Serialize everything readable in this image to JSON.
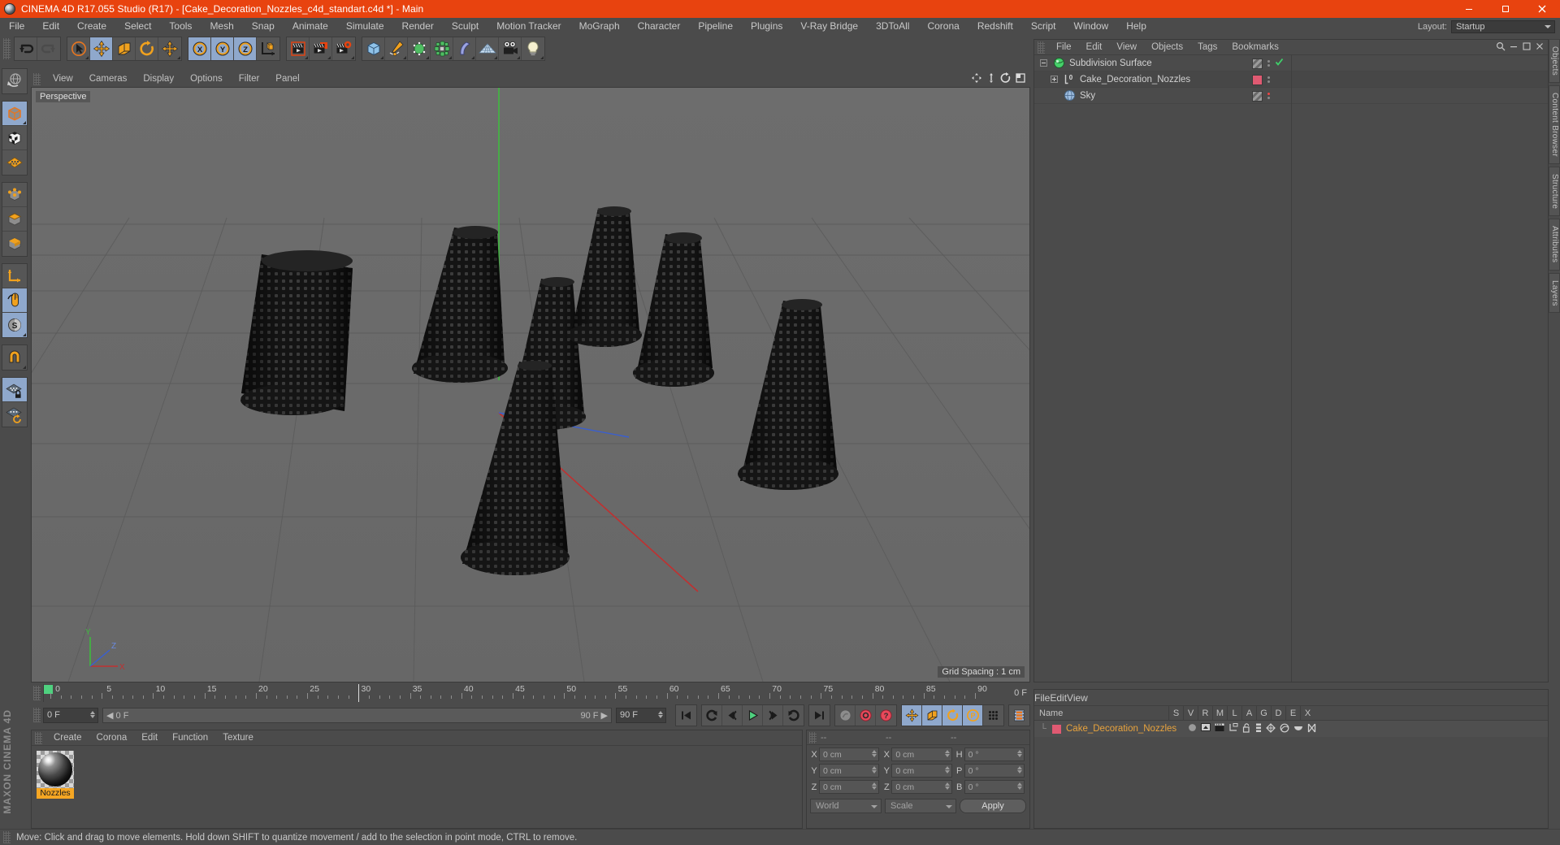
{
  "window": {
    "title": "CINEMA 4D R17.055 Studio (R17) - [Cake_Decoration_Nozzles_c4d_standart.c4d *] - Main",
    "minimize": "–",
    "maximize": "▢",
    "close": "✕"
  },
  "menubar": {
    "items": [
      "File",
      "Edit",
      "Create",
      "Select",
      "Tools",
      "Mesh",
      "Snap",
      "Animate",
      "Simulate",
      "Render",
      "Sculpt",
      "Motion Tracker",
      "MoGraph",
      "Character",
      "Pipeline",
      "Plugins",
      "V-Ray Bridge",
      "3DToAll",
      "Corona",
      "Redshift",
      "Script",
      "Window",
      "Help"
    ],
    "layout_label": "Layout:",
    "layout_value": "Startup"
  },
  "toolbar": {
    "groups": [
      {
        "name": "history",
        "buttons": [
          {
            "name": "undo-button",
            "icon": "undo-icon",
            "active": false,
            "disabled": false
          },
          {
            "name": "redo-button",
            "icon": "redo-icon",
            "active": false,
            "disabled": true
          }
        ]
      },
      {
        "name": "transform",
        "buttons": [
          {
            "name": "live-selection-button",
            "icon": "cursor-circle-icon",
            "active": false,
            "disabled": false
          },
          {
            "name": "move-tool-button",
            "icon": "move-arrows-icon",
            "active": true,
            "disabled": false
          },
          {
            "name": "scale-tool-button",
            "icon": "scale-box-icon",
            "active": false,
            "disabled": false
          },
          {
            "name": "rotate-tool-button",
            "icon": "rotate-arc-icon",
            "active": false,
            "disabled": false
          },
          {
            "name": "move-dup-button",
            "icon": "move-arrows-icon",
            "active": false,
            "disabled": false
          }
        ]
      },
      {
        "name": "axis-locks",
        "buttons": [
          {
            "name": "lock-x-button",
            "icon": "axis-x-icon",
            "active": true,
            "disabled": false
          },
          {
            "name": "lock-y-button",
            "icon": "axis-y-icon",
            "active": true,
            "disabled": false
          },
          {
            "name": "lock-z-button",
            "icon": "axis-z-icon",
            "active": true,
            "disabled": false
          },
          {
            "name": "world-coordinates-button",
            "icon": "world-axis-cube-icon",
            "active": false,
            "disabled": false
          }
        ]
      },
      {
        "name": "render",
        "buttons": [
          {
            "name": "render-view-button",
            "icon": "clapper-play-icon",
            "active": false,
            "disabled": false
          },
          {
            "name": "render-to-picture-viewer-button",
            "icon": "clapper-picture-icon",
            "active": false,
            "disabled": false
          },
          {
            "name": "render-settings-button",
            "icon": "clapper-gear-icon",
            "active": false,
            "disabled": false
          }
        ]
      },
      {
        "name": "create",
        "buttons": [
          {
            "name": "add-cube-button",
            "icon": "cube-blue-icon",
            "active": false,
            "disabled": false
          },
          {
            "name": "add-spline-button",
            "icon": "pen-spline-icon",
            "active": false,
            "disabled": false
          },
          {
            "name": "add-nurbs-button",
            "icon": "nurbs-green-icon",
            "active": false,
            "disabled": false
          },
          {
            "name": "add-array-button",
            "icon": "array-green-icon",
            "active": false,
            "disabled": false
          },
          {
            "name": "add-bend-button",
            "icon": "bend-deformer-icon",
            "active": false,
            "disabled": false
          },
          {
            "name": "add-floor-button",
            "icon": "floor-grid-icon",
            "active": false,
            "disabled": false
          },
          {
            "name": "add-camera-button",
            "icon": "camera-icon",
            "active": false,
            "disabled": false
          },
          {
            "name": "add-light-button",
            "icon": "light-bulb-icon",
            "active": false,
            "disabled": false
          }
        ]
      }
    ]
  },
  "left_toolbar": {
    "groups": [
      [
        {
          "name": "undo-view-button",
          "icon": "globe-undo-icon",
          "active": false
        }
      ],
      [
        {
          "name": "model-mode-button",
          "icon": "cube-solid-icon",
          "active": true
        },
        {
          "name": "texture-mode-button",
          "icon": "cube-checker-icon",
          "active": false
        },
        {
          "name": "workplane-mode-button",
          "icon": "grid-plane-icon",
          "active": false
        }
      ],
      [
        {
          "name": "points-mode-button",
          "icon": "cube-points-icon",
          "active": false
        },
        {
          "name": "edges-mode-button",
          "icon": "cube-edges-icon",
          "active": false
        },
        {
          "name": "polygons-mode-button",
          "icon": "cube-polygons-icon",
          "active": false
        }
      ],
      [
        {
          "name": "object-axis-button",
          "icon": "axis-corner-icon",
          "active": false
        },
        {
          "name": "viewport-solo-button",
          "icon": "mouse-icon",
          "active": true
        },
        {
          "name": "enable-axis-button",
          "icon": "s-circle-icon",
          "active": true
        }
      ],
      [
        {
          "name": "magnet-tool-button",
          "icon": "magnet-icon",
          "active": false
        }
      ],
      [
        {
          "name": "workplane-lock-button",
          "icon": "grid-lock-icon",
          "active": true
        },
        {
          "name": "workplane-rotate-button",
          "icon": "grid-rotate-icon",
          "active": false
        }
      ]
    ],
    "brand": "MAXON CINEMA 4D"
  },
  "viewport": {
    "menu": [
      "View",
      "Cameras",
      "Display",
      "Options",
      "Filter",
      "Panel"
    ],
    "label": "Perspective",
    "grid_spacing": "Grid Spacing : 1 cm",
    "header_icons": [
      "move-view-icon",
      "pan-view-icon",
      "rotate-view-icon",
      "maximize-view-icon"
    ],
    "scene": {
      "objects": "7 black textured cone-shaped cake decoration nozzles on a grey grid floor",
      "background_color": "#6b6b6b",
      "floor_color": "#6e6e6e",
      "object_color": "#1a1a1a",
      "axis_x_color": "#c03030",
      "axis_y_color": "#3fbb3f",
      "axis_z_color": "#3a5fd0"
    }
  },
  "object_manager": {
    "menu": [
      "File",
      "Edit",
      "View",
      "Objects",
      "Tags",
      "Bookmarks"
    ],
    "rows": [
      {
        "name": "Subdivision Surface",
        "icon": "subdivision-surface-icon",
        "selected": false,
        "indent": 0,
        "expander": "minus",
        "tag_color": "#8a8a8a",
        "check": true
      },
      {
        "name": "Cake_Decoration_Nozzles",
        "icon": "null-object-icon",
        "selected": false,
        "indent": 1,
        "expander": "plus",
        "tag_color": "#e05a72",
        "check": false
      },
      {
        "name": "Sky",
        "icon": "sky-object-icon",
        "selected": false,
        "indent": 1,
        "expander": "none",
        "tag_color": "#8a8a8a",
        "check": false
      }
    ]
  },
  "dock_right": {
    "tabs": [
      "Objects",
      "Content Browser",
      "Structure",
      "Attributes",
      "Layers"
    ]
  },
  "timeline": {
    "labels": [
      "0",
      "5",
      "10",
      "15",
      "20",
      "25",
      "30",
      "35",
      "40",
      "45",
      "50",
      "55",
      "60",
      "65",
      "70",
      "75",
      "80",
      "85",
      "90"
    ],
    "current_frame": "0 F",
    "end_frame": "90 F",
    "range_start": "0 F",
    "range_end": "90 F",
    "max_frames": 90
  },
  "playback": {
    "buttons": [
      {
        "name": "go-to-start-button",
        "icon": "skip-start-icon",
        "active": false
      },
      {
        "name": "play-backward-frame-button",
        "icon": "rewind-loop-icon",
        "active": false
      },
      {
        "name": "previous-frame-button",
        "icon": "step-back-icon",
        "active": false
      },
      {
        "name": "play-button",
        "icon": "play-icon",
        "active": false
      },
      {
        "name": "next-frame-button",
        "icon": "step-forward-icon",
        "active": false
      },
      {
        "name": "play-forward-loop-button",
        "icon": "forward-loop-icon",
        "active": false
      },
      {
        "name": "go-to-end-button",
        "icon": "skip-end-icon",
        "active": false
      },
      {
        "name": "record-active-objects-button",
        "icon": "key-disabled-icon",
        "active": false
      },
      {
        "name": "autokeying-button",
        "icon": "record-circle-icon",
        "active": false
      },
      {
        "name": "keyframe-selection-button",
        "icon": "question-circle-icon",
        "active": false
      },
      {
        "name": "record-position-button",
        "icon": "position-arrows-icon",
        "active": true
      },
      {
        "name": "record-scale-button",
        "icon": "scale-box-icon",
        "active": true
      },
      {
        "name": "record-rotation-button",
        "icon": "rotation-icon",
        "active": true
      },
      {
        "name": "record-param-button",
        "icon": "param-p-icon",
        "active": true
      },
      {
        "name": "record-pla-button",
        "icon": "point-level-icon",
        "active": false
      },
      {
        "name": "timeline-toggle-button",
        "icon": "film-strip-icon",
        "active": false
      }
    ]
  },
  "material_manager": {
    "menu": [
      "Create",
      "Corona",
      "Edit",
      "Function",
      "Texture"
    ],
    "materials": [
      {
        "name": "Nozzles",
        "selected": true
      }
    ]
  },
  "coordinates": {
    "headers": [
      "--",
      "--",
      "--"
    ],
    "rows": [
      {
        "labels": [
          "X",
          "X",
          "H"
        ],
        "values": [
          "0 cm",
          "0 cm",
          "0 °"
        ]
      },
      {
        "labels": [
          "Y",
          "Y",
          "P"
        ],
        "values": [
          "0 cm",
          "0 cm",
          "0 °"
        ]
      },
      {
        "labels": [
          "Z",
          "Z",
          "B"
        ],
        "values": [
          "0 cm",
          "0 cm",
          "0 °"
        ]
      }
    ],
    "system": "World",
    "mode": "Scale",
    "apply": "Apply"
  },
  "layer_manager": {
    "menu": [
      "File",
      "Edit",
      "View"
    ],
    "columns": [
      "Name",
      "S",
      "V",
      "R",
      "M",
      "L",
      "A",
      "G",
      "D",
      "E",
      "X"
    ],
    "rows": [
      {
        "name": "Cake_Decoration_Nozzles",
        "color": "#e05a72"
      }
    ]
  },
  "statusbar": {
    "text": "Move: Click and drag to move elements. Hold down SHIFT to quantize movement / add to the selection in point mode, CTRL to remove."
  },
  "colors": {
    "accent_orange": "#e8430f",
    "panel_bg": "#4b4b4b",
    "button_bg": "#565656",
    "active_blue": "#8fa8cc",
    "text": "#c8c8c8",
    "selected_text": "#e8a33d",
    "material_label": "#f5a623"
  }
}
